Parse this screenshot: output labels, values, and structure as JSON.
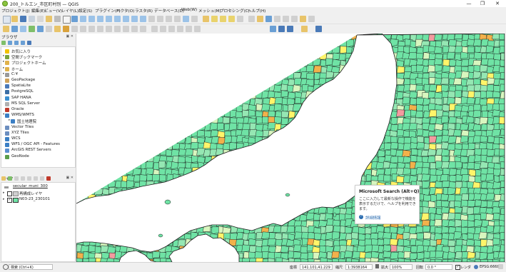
{
  "window": {
    "title": "200_トルエン_市区町村別 — QGIS",
    "buttons": [
      "—",
      "❐",
      "✕"
    ]
  },
  "menu": [
    "プロジェクト(J)",
    "編集(E)",
    "ビュー(V)",
    "レイヤ(L)",
    "設定(S)",
    "プラグイン(P)",
    "ベクタ(O)",
    "ラスタ(R)",
    "データベース(D)",
    "Web(W)",
    "メッシュ(M)",
    "プロセシング(C)",
    "ヘルプ(H)"
  ],
  "browser_panel": {
    "title": "ブラウザ",
    "items": [
      {
        "label": "お気に入り",
        "icon": "star-icon",
        "color": "#f2c200"
      },
      {
        "label": "空間ブックマーク",
        "icon": "bookmark-icon",
        "color": "#7aa33b"
      },
      {
        "label": "プロジェクトホーム",
        "icon": "folder-icon",
        "color": "#e0b24a"
      },
      {
        "label": "ホーム",
        "icon": "folder-icon",
        "color": "#e0b24a"
      },
      {
        "label": "C:¥",
        "icon": "drive-icon",
        "color": "#9a9a9a"
      },
      {
        "label": "GeoPackage",
        "icon": "geopackage-icon",
        "color": "#cfa25a"
      },
      {
        "label": "SpatiaLite",
        "icon": "spatialite-icon",
        "color": "#4a79b8"
      },
      {
        "label": "PostgreSQL",
        "icon": "postgresql-icon",
        "color": "#3b6ea5"
      },
      {
        "label": "SAP HANA",
        "icon": "saphana-icon",
        "color": "#3a8fd0"
      },
      {
        "label": "MS SQL Server",
        "icon": "mssql-icon",
        "color": "#b0b0b0"
      },
      {
        "label": "Oracle",
        "icon": "oracle-icon",
        "color": "#c0392b"
      },
      {
        "label": "WMS/WMTS",
        "icon": "wms-icon",
        "color": "#3b7fc4"
      },
      {
        "label": "国土地理院",
        "icon": "wms-layer-icon",
        "color": "#3b7fc4"
      },
      {
        "label": "Vector Tiles",
        "icon": "vector-tiles-icon",
        "color": "#6c8ebf"
      },
      {
        "label": "XYZ Tiles",
        "icon": "xyz-tiles-icon",
        "color": "#6c8ebf"
      },
      {
        "label": "WCS",
        "icon": "wcs-icon",
        "color": "#3b7fc4"
      },
      {
        "label": "WFS / OGC API - Features",
        "icon": "wfs-icon",
        "color": "#3b7fc4"
      },
      {
        "label": "ArcGIS REST Servers",
        "icon": "arcgis-icon",
        "color": "#5a8fcf"
      },
      {
        "label": "GeoNode",
        "icon": "geonode-icon",
        "color": "#5a9e4a"
      }
    ]
  },
  "layers_panel": {
    "title": "レイヤ",
    "layers": [
      {
        "label": "secular_muni_300",
        "icon": "group-icon"
      },
      {
        "label": "再構成レイヤ",
        "icon": "polygon-layer-icon"
      },
      {
        "label": "N03-23_230101",
        "icon": "polygon-layer-icon"
      }
    ]
  },
  "tooltip": {
    "title": "Microsoft Search (Alt+Q)",
    "body": "ここに入力して最新な操作で機能を表示するだけで、ヘルプを利用できます。",
    "link": "詳細情報"
  },
  "status": {
    "search_placeholder": "検索 (Ctrl+K)",
    "coord_label": "座標",
    "coord_value": "141.101,41.229",
    "scale_label": "縮尺",
    "scale_value": "1:3938164",
    "magnifier_label": "拡大",
    "magnifier_value": "100%",
    "rotation_label": "回転",
    "rotation_value": "0.0 °",
    "render_label": "レンダ",
    "crs": "EPSG:6668"
  },
  "map": {
    "colors": {
      "ocean": "#ffffff",
      "land_main": "#6fe3a5",
      "land_alt": "#95e7b3",
      "pale": "#d8f6bf",
      "yellow": "#fff56a",
      "orange": "#f2b14b",
      "pink": "#f39a9f",
      "red": "#d9342b",
      "darkred": "#9b0000",
      "border": "#1b1b1b"
    }
  }
}
